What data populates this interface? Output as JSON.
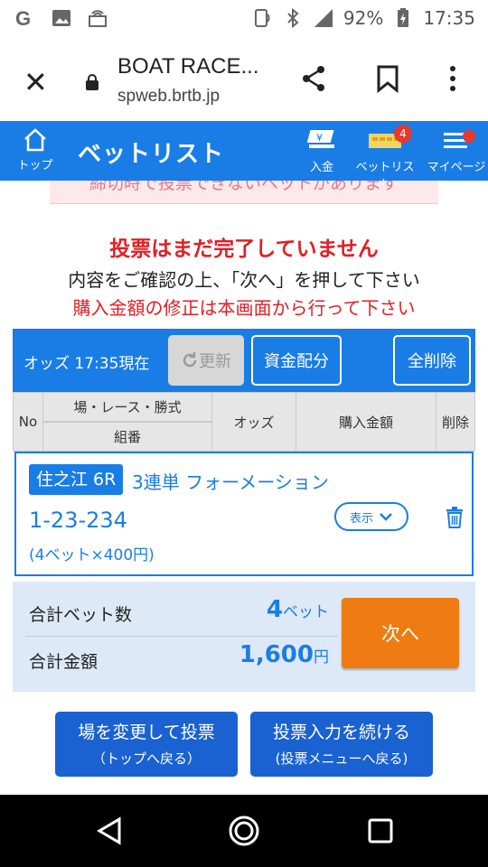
{
  "status_bar": {
    "battery": "92%",
    "time": "17:35",
    "network": "4G"
  },
  "browser": {
    "title": "BOAT RACE...",
    "url": "spweb.brtb.jp"
  },
  "app_header": {
    "home_label": "トップ",
    "page_title": "ベットリスト",
    "nav": [
      {
        "label": "入金"
      },
      {
        "label": "ベットリスト",
        "badge": "4"
      },
      {
        "label": "マイページ"
      }
    ]
  },
  "warning_partial": "締切時で投票できないベットがあります",
  "messages": {
    "not_complete": "投票はまだ完了していません",
    "confirm": "内容をご確認の上、「次へ」を押して下さい",
    "amount_note": "購入金額の修正は本画面から行って下さい"
  },
  "toolbar": {
    "odds_time": "オッズ 17:35現在",
    "refresh_label": "更新",
    "allocate_label": "資金配分",
    "delete_all_label": "全削除"
  },
  "table_header": {
    "no": "No",
    "venue_race_type": "場・レース・勝式",
    "combination": "組番",
    "odds": "オッズ",
    "amount": "購入金額",
    "delete": "削除"
  },
  "bet": {
    "venue_race": "住之江 6R",
    "bet_type": "3連単 フォーメーション",
    "combination": "1-23-234",
    "detail": "(4ベット×400円)",
    "show_label": "表示"
  },
  "summary": {
    "count_label": "合計ベット数",
    "count_value": "4",
    "count_unit": "ベット",
    "amount_label": "合計金額",
    "amount_value": "1,600",
    "amount_unit": "円",
    "next_label": "次へ"
  },
  "bottom_buttons": [
    {
      "line1": "場を変更して投票",
      "line2": "（トップへ戻る）"
    },
    {
      "line1": "投票入力を続ける",
      "line2": "(投票メニューへ戻る)"
    }
  ],
  "colors": {
    "primary": "#1a7de6",
    "accent": "#ee7c12",
    "alert": "#e31e24"
  }
}
